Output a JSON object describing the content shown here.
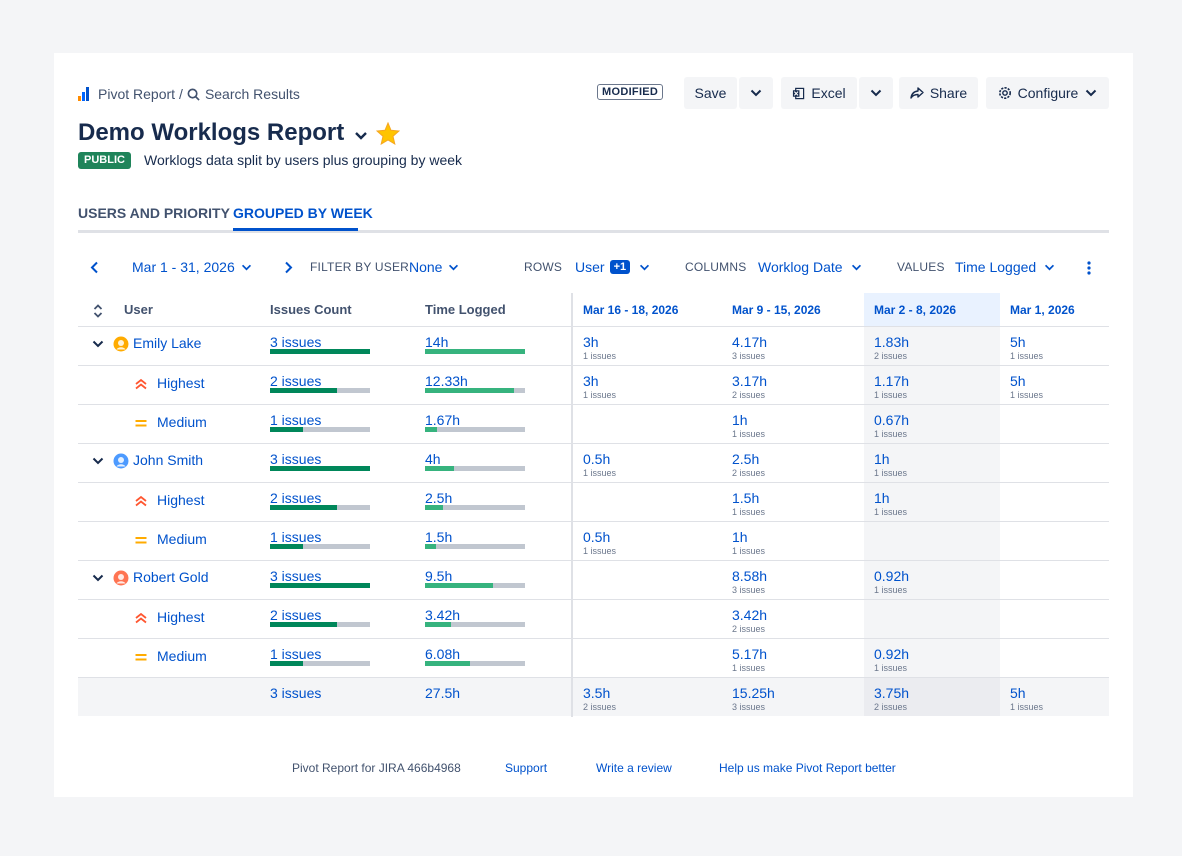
{
  "breadcrumb": {
    "app": "Pivot Report",
    "separator": "/",
    "search": "Search Results"
  },
  "status": "MODIFIED",
  "actions": {
    "save": "Save",
    "excel": "Excel",
    "share": "Share",
    "configure": "Configure"
  },
  "report": {
    "title": "Demo Worklogs Report",
    "visibility": "PUBLIC",
    "description": "Worklogs data split by users plus grouping by week"
  },
  "tabs": [
    {
      "label": "USERS AND PRIORITY"
    },
    {
      "label": "GROUPED BY WEEK"
    }
  ],
  "toolbar": {
    "date_range": "Mar 1 - 31, 2026",
    "filter_label": "FILTER BY USER",
    "filter_value": "None",
    "rows_label": "ROWS",
    "rows_value": "User",
    "rows_extra": "+1",
    "columns_label": "COLUMNS",
    "columns_value": "Worklog Date",
    "values_label": "VALUES",
    "values_value": "Time Logged"
  },
  "table": {
    "headers": {
      "user": "User",
      "issues": "Issues Count",
      "time": "Time Logged"
    },
    "date_columns": [
      "Mar 16 - 18, 2026",
      "Mar 9 - 15, 2026",
      "Mar 2 - 8, 2026",
      "Mar 1, 2026"
    ],
    "rows": [
      {
        "type": "user",
        "label": "Emily Lake",
        "issues": "3 issues",
        "issues_frac": 1.0,
        "time": "14h",
        "time_frac": 1.0,
        "cells": [
          {
            "v": "3h",
            "s": "1 issues"
          },
          {
            "v": "4.17h",
            "s": "3 issues"
          },
          {
            "v": "1.83h",
            "s": "2 issues"
          },
          {
            "v": "5h",
            "s": "1 issues"
          }
        ]
      },
      {
        "type": "priority",
        "prio": "highest",
        "label": "Highest",
        "issues": "2 issues",
        "issues_frac": 0.67,
        "time": "12.33h",
        "time_frac": 0.89,
        "cells": [
          {
            "v": "3h",
            "s": "1 issues"
          },
          {
            "v": "3.17h",
            "s": "2 issues"
          },
          {
            "v": "1.17h",
            "s": "1 issues"
          },
          {
            "v": "5h",
            "s": "1 issues"
          }
        ]
      },
      {
        "type": "priority",
        "prio": "medium",
        "label": "Medium",
        "issues": "1 issues",
        "issues_frac": 0.33,
        "time": "1.67h",
        "time_frac": 0.12,
        "cells": [
          null,
          {
            "v": "1h",
            "s": "1 issues"
          },
          {
            "v": "0.67h",
            "s": "1 issues"
          },
          null
        ]
      },
      {
        "type": "user",
        "label": "John Smith",
        "issues": "3 issues",
        "issues_frac": 1.0,
        "time": "4h",
        "time_frac": 0.29,
        "cells": [
          {
            "v": "0.5h",
            "s": "1 issues"
          },
          {
            "v": "2.5h",
            "s": "2 issues"
          },
          {
            "v": "1h",
            "s": "1 issues"
          },
          null
        ]
      },
      {
        "type": "priority",
        "prio": "highest",
        "label": "Highest",
        "issues": "2 issues",
        "issues_frac": 0.67,
        "time": "2.5h",
        "time_frac": 0.18,
        "cells": [
          null,
          {
            "v": "1.5h",
            "s": "1 issues"
          },
          {
            "v": "1h",
            "s": "1 issues"
          },
          null
        ]
      },
      {
        "type": "priority",
        "prio": "medium",
        "label": "Medium",
        "issues": "1 issues",
        "issues_frac": 0.33,
        "time": "1.5h",
        "time_frac": 0.11,
        "cells": [
          {
            "v": "0.5h",
            "s": "1 issues"
          },
          {
            "v": "1h",
            "s": "1 issues"
          },
          null,
          null
        ]
      },
      {
        "type": "user",
        "label": "Robert Gold",
        "issues": "3 issues",
        "issues_frac": 1.0,
        "time": "9.5h",
        "time_frac": 0.68,
        "cells": [
          null,
          {
            "v": "8.58h",
            "s": "3 issues"
          },
          {
            "v": "0.92h",
            "s": "1 issues"
          },
          null
        ]
      },
      {
        "type": "priority",
        "prio": "highest",
        "label": "Highest",
        "issues": "2 issues",
        "issues_frac": 0.67,
        "time": "3.42h",
        "time_frac": 0.26,
        "cells": [
          null,
          {
            "v": "3.42h",
            "s": "2 issues"
          },
          null,
          null
        ]
      },
      {
        "type": "priority",
        "prio": "medium",
        "label": "Medium",
        "issues": "1 issues",
        "issues_frac": 0.33,
        "time": "6.08h",
        "time_frac": 0.45,
        "cells": [
          null,
          {
            "v": "5.17h",
            "s": "1 issues"
          },
          {
            "v": "0.92h",
            "s": "1 issues"
          },
          null
        ]
      }
    ],
    "totals": {
      "issues": "3 issues",
      "time": "27.5h",
      "cells": [
        {
          "v": "3.5h",
          "s": "2 issues"
        },
        {
          "v": "15.25h",
          "s": "3 issues"
        },
        {
          "v": "3.75h",
          "s": "2 issues"
        },
        {
          "v": "5h",
          "s": "1 issues"
        }
      ]
    }
  },
  "footer": {
    "product": "Pivot Report for JIRA 466b4968",
    "support": "Support",
    "review": "Write a review",
    "feedback": "Help us make Pivot Report better"
  },
  "colors": {
    "accent": "#0052cc",
    "public_badge": "#1f845a",
    "issues_bar": "#00875a",
    "time_bar": "#36b37e",
    "highest": "#ff5630",
    "medium": "#ffab00"
  }
}
